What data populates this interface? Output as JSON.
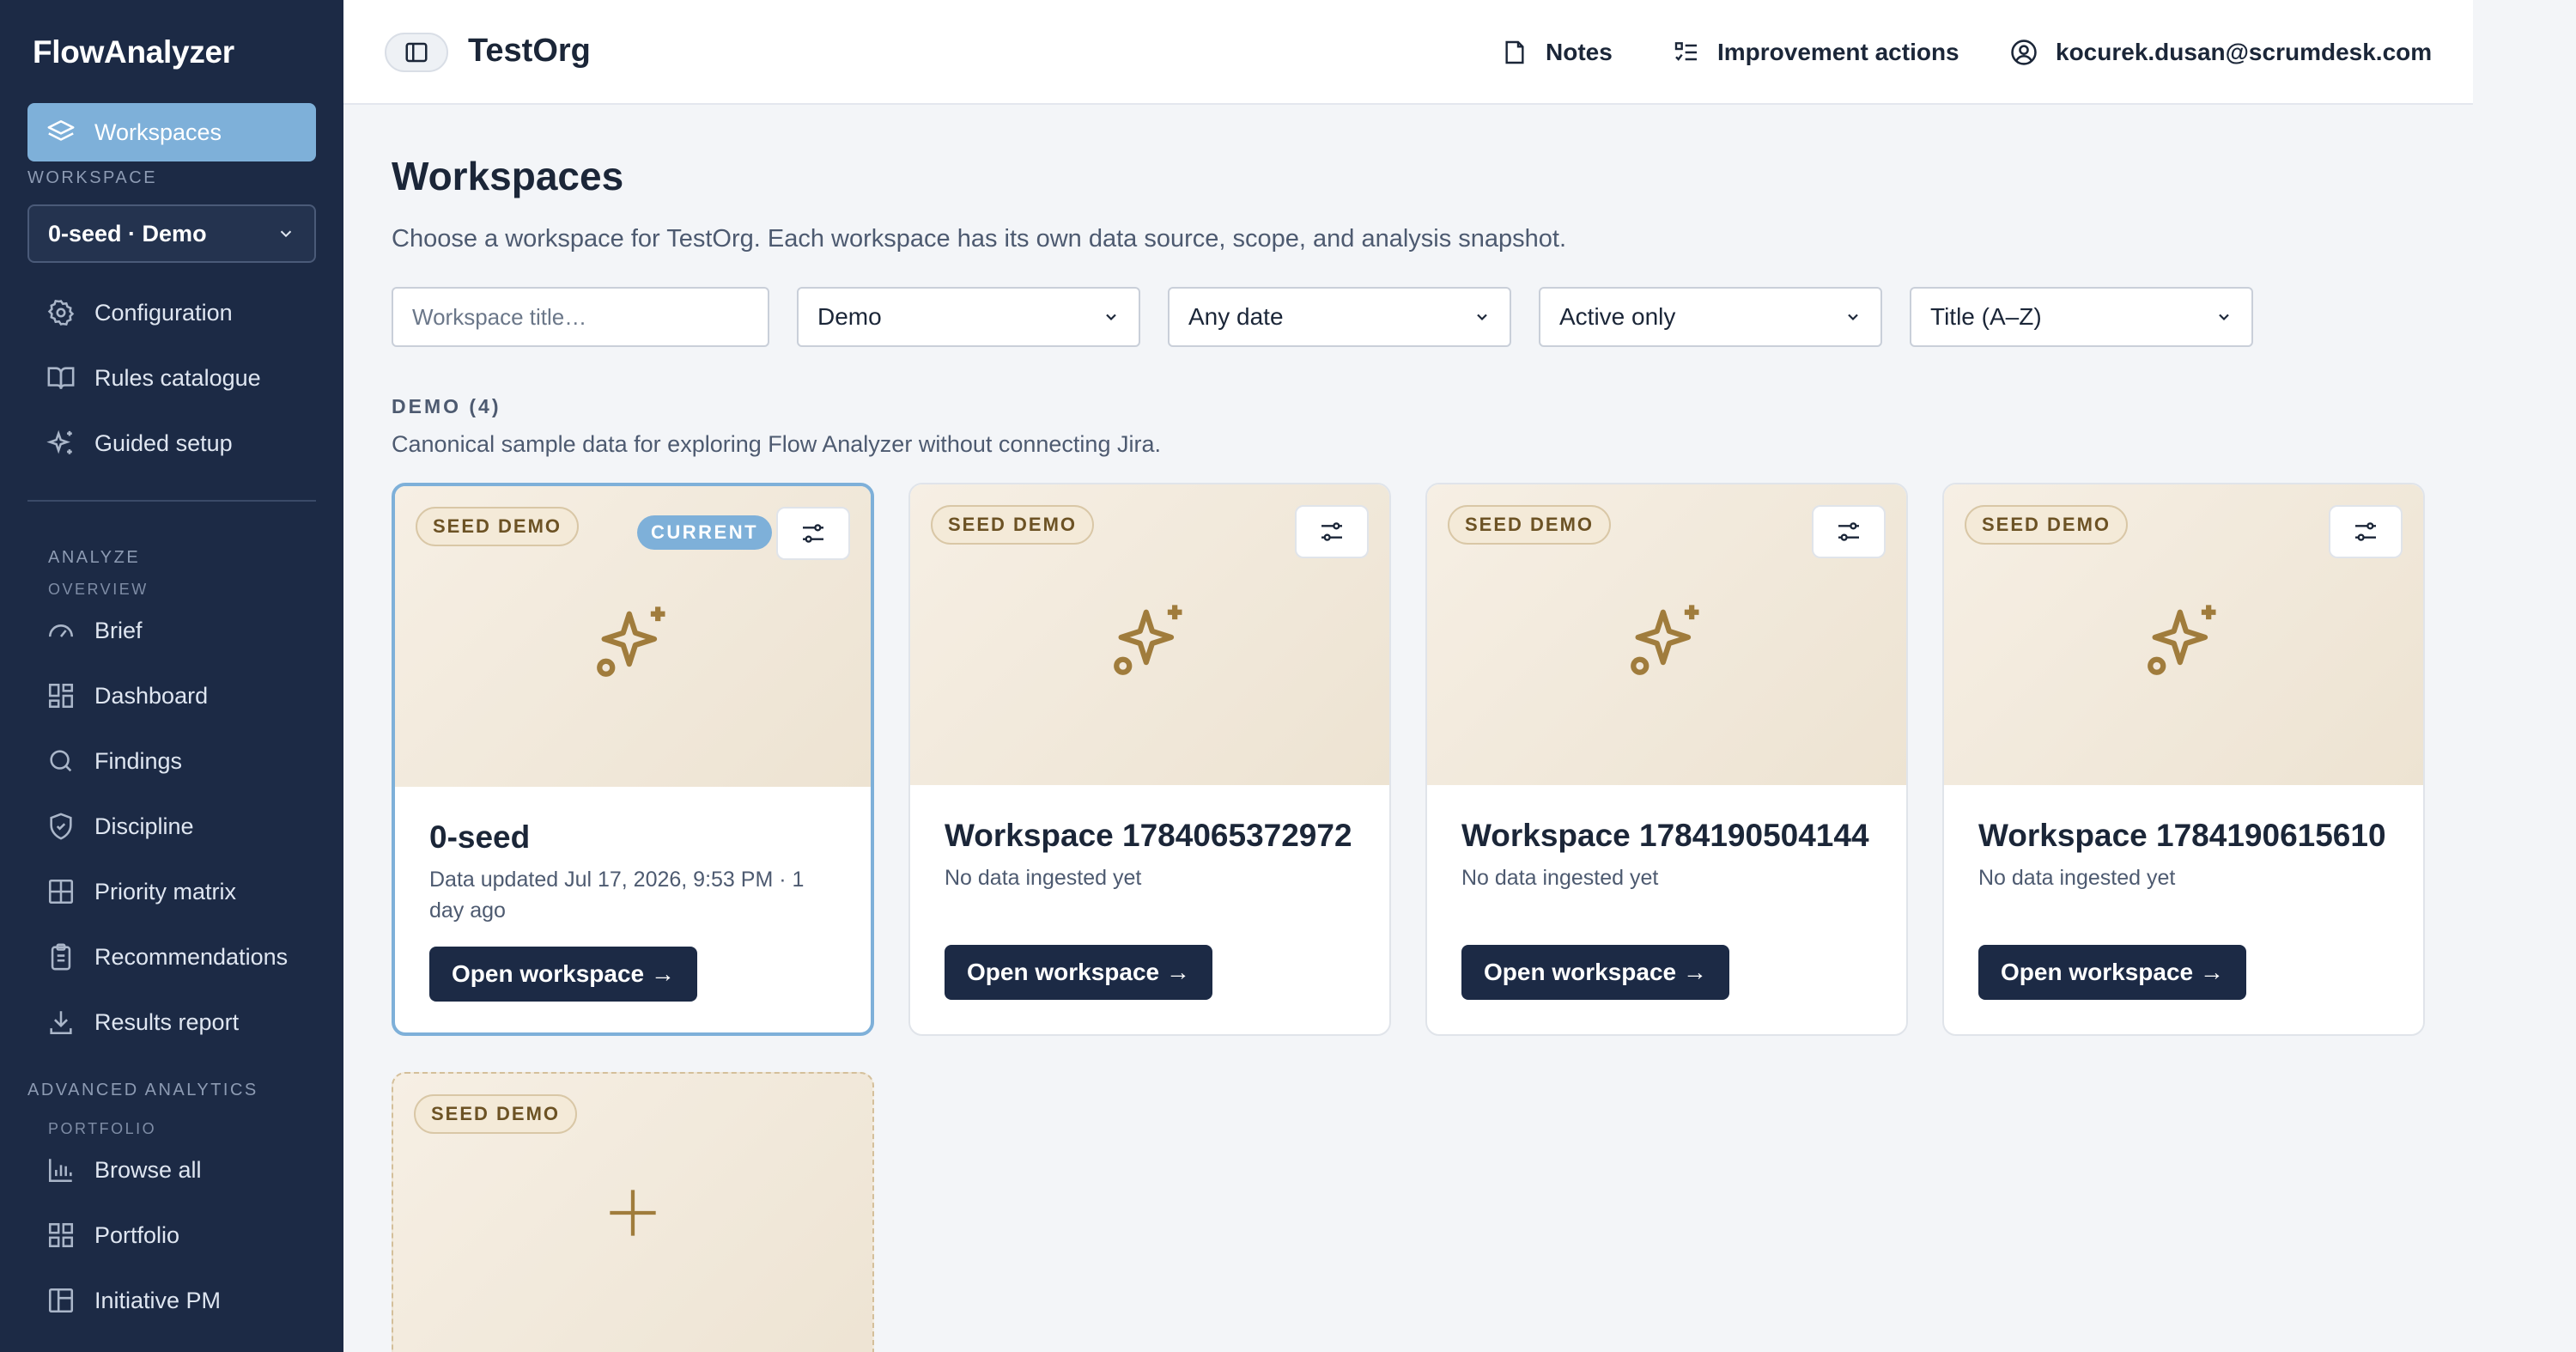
{
  "app": {
    "brand": "FlowAnalyzer"
  },
  "sidebar": {
    "active_item": "Workspaces",
    "workspace_label": "WORKSPACE",
    "workspace_value": "0-seed · Demo",
    "items_top": [
      "Configuration",
      "Rules catalogue",
      "Guided setup"
    ],
    "analyze_label": "ANALYZE",
    "overview_label": "OVERVIEW",
    "analyze_items": [
      "Brief",
      "Dashboard",
      "Findings",
      "Discipline",
      "Priority matrix",
      "Recommendations",
      "Results report"
    ],
    "advanced_label": "ADVANCED ANALYTICS",
    "portfolio_label": "PORTFOLIO",
    "advanced_items": [
      "Browse all",
      "Portfolio",
      "Initiative PM"
    ]
  },
  "topbar": {
    "org": "TestOrg",
    "notes": "Notes",
    "improvement": "Improvement actions",
    "user": "kocurek.dusan@scrumdesk.com"
  },
  "main": {
    "title": "Workspaces",
    "subtitle": "Choose a workspace for TestOrg. Each workspace has its own data source, scope, and analysis snapshot.",
    "filters": {
      "search_placeholder": "Workspace title…",
      "source": "Demo",
      "date": "Any date",
      "status": "Active only",
      "sort": "Title (A–Z)"
    },
    "section_label": "DEMO (4)",
    "section_desc": "Canonical sample data for exploring Flow Analyzer without connecting Jira.",
    "badge": "SEED DEMO",
    "current_badge": "CURRENT",
    "open_label": "Open workspace →",
    "cards": [
      {
        "title": "0-seed",
        "meta": "Data updated Jul 17, 2026, 9:53 PM · 1 day ago"
      },
      {
        "title": "Workspace 1784065372972",
        "meta": "No data ingested yet"
      },
      {
        "title": "Workspace 1784190504144",
        "meta": "No data ingested yet"
      },
      {
        "title": "Workspace 1784190615610",
        "meta": "No data ingested yet"
      }
    ]
  },
  "colors": {
    "sidebar": "#1c2a45",
    "accent": "#7eb0d9",
    "button": "#1c2a45",
    "hero": "#f1e8da",
    "icon": "#a07c3c"
  }
}
